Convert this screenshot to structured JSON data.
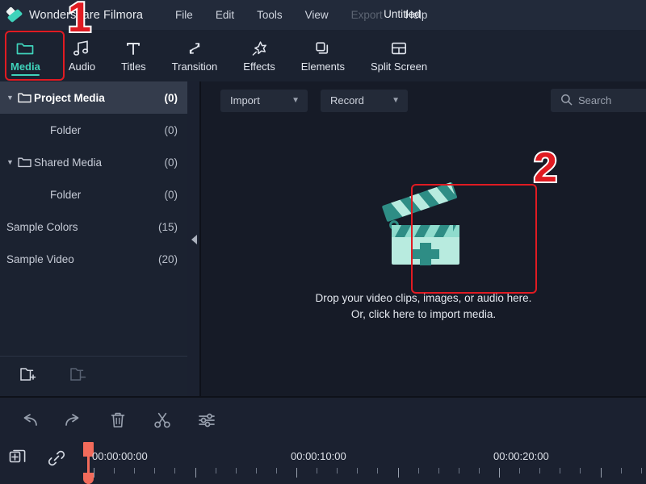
{
  "app": {
    "name": "Wondershare Filmora",
    "logo_icon": "filmora-diamond-logo",
    "document_title": "Untitled"
  },
  "menu": {
    "items": [
      {
        "label": "File",
        "disabled": false
      },
      {
        "label": "Edit",
        "disabled": false
      },
      {
        "label": "Tools",
        "disabled": false
      },
      {
        "label": "View",
        "disabled": false
      },
      {
        "label": "Export",
        "disabled": true
      },
      {
        "label": "Help",
        "disabled": false
      }
    ]
  },
  "tool_tabs": {
    "active": "Media",
    "items": [
      {
        "label": "Media",
        "icon": "folder-icon"
      },
      {
        "label": "Audio",
        "icon": "music-note-icon"
      },
      {
        "label": "Titles",
        "icon": "text-t-icon"
      },
      {
        "label": "Transition",
        "icon": "transition-arrows-icon"
      },
      {
        "label": "Effects",
        "icon": "sparkle-star-icon"
      },
      {
        "label": "Elements",
        "icon": "stacked-squares-icon"
      },
      {
        "label": "Split Screen",
        "icon": "split-screen-icon"
      }
    ]
  },
  "sidebar": {
    "items": [
      {
        "label": "Project Media",
        "count": "(0)",
        "caret": "expanded",
        "icon": "folder-icon",
        "selected": true,
        "indent": 0
      },
      {
        "label": "Folder",
        "count": "(0)",
        "caret": "none",
        "icon": "none",
        "selected": false,
        "indent": 1
      },
      {
        "label": "Shared Media",
        "count": "(0)",
        "caret": "expanded",
        "icon": "folder-icon",
        "selected": false,
        "indent": 0
      },
      {
        "label": "Folder",
        "count": "(0)",
        "caret": "none",
        "icon": "none",
        "selected": false,
        "indent": 1
      },
      {
        "label": "Sample Colors",
        "count": "(15)",
        "caret": "none",
        "icon": "none",
        "selected": false,
        "indent": 0
      },
      {
        "label": "Sample Video",
        "count": "(20)",
        "caret": "none",
        "icon": "none",
        "selected": false,
        "indent": 0
      }
    ],
    "footer": {
      "new_folder_icon": "folder-add-icon",
      "delete_folder_icon": "folder-remove-icon"
    },
    "collapse_handle_icon": "chevron-left-icon"
  },
  "media_panel": {
    "import_button": {
      "label": "Import",
      "chevron": "chevron-down-icon"
    },
    "record_button": {
      "label": "Record",
      "chevron": "chevron-down-icon"
    },
    "search": {
      "placeholder": "Search",
      "icon": "search-icon",
      "value": ""
    },
    "dropzone": {
      "icon": "clapperboard-plus-icon",
      "line1": "Drop your video clips, images, or audio here.",
      "line2": "Or, click here to import media."
    }
  },
  "timeline": {
    "toolbar_icons": [
      {
        "name": "undo-icon",
        "label": "Undo"
      },
      {
        "name": "redo-icon",
        "label": "Redo"
      },
      {
        "name": "trash-icon",
        "label": "Delete"
      },
      {
        "name": "scissors-icon",
        "label": "Split"
      },
      {
        "name": "sliders-icon",
        "label": "Adjust"
      }
    ],
    "left_icons": [
      {
        "name": "add-track-icon",
        "label": "Add Track"
      },
      {
        "name": "link-icon",
        "label": "Link"
      }
    ],
    "ruler_labels": [
      "00:00:00:00",
      "00:00:10:00",
      "00:00:20:00"
    ],
    "playhead_position": "00:00:00:00"
  },
  "annotations": [
    {
      "label": "1",
      "target": "Media tab"
    },
    {
      "label": "2",
      "target": "Clapperboard import icon"
    }
  ],
  "colors": {
    "accent_teal": "#3fd3bb",
    "annotation_red": "#e01b22",
    "playhead": "#f26b5b",
    "menubar_bg": "#222a3a",
    "panel_bg": "#1b2230",
    "media_bg": "#161b27"
  }
}
